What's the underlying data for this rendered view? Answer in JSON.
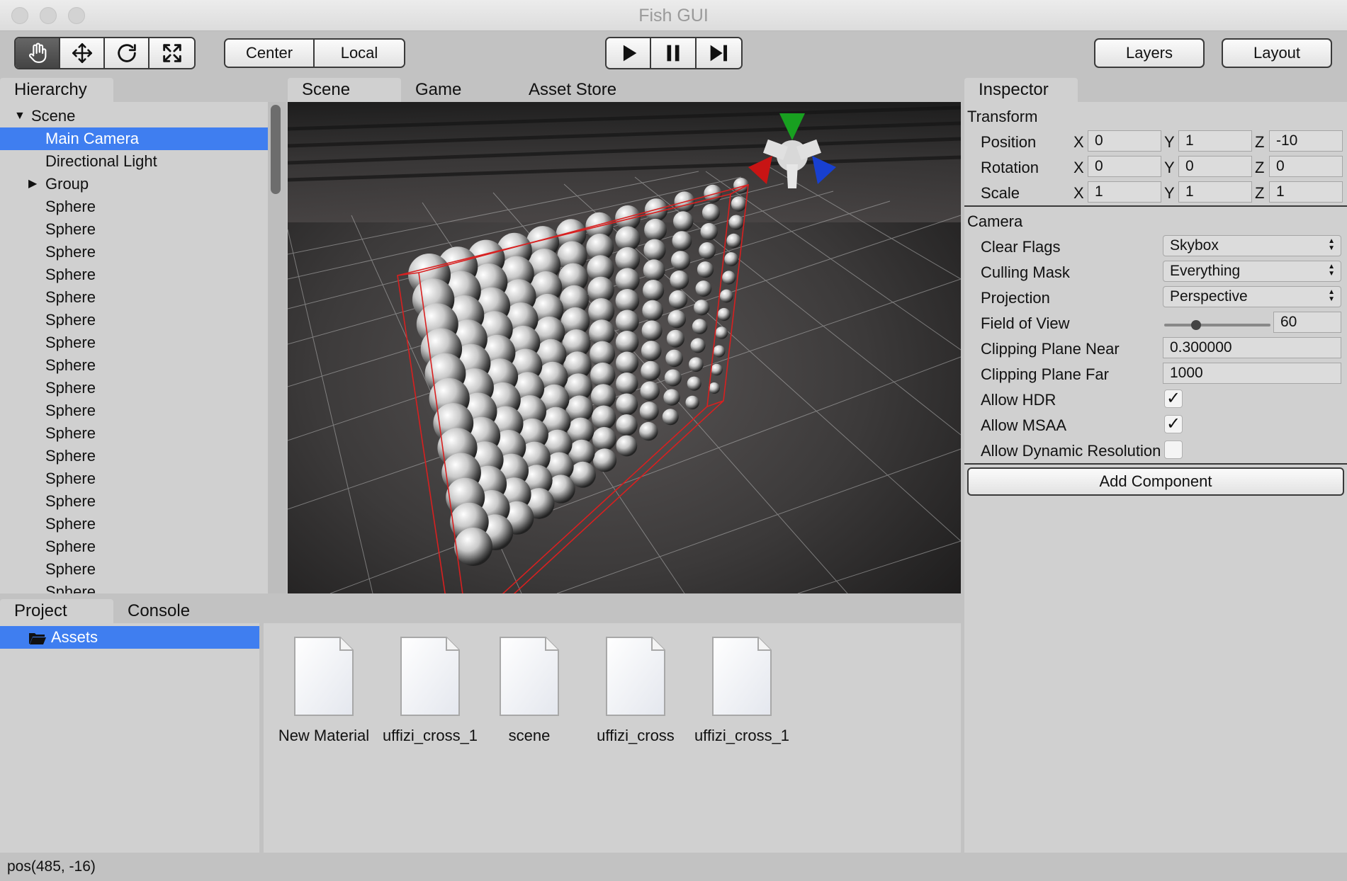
{
  "window": {
    "title": "Fish GUI"
  },
  "toolbar": {
    "tools": [
      {
        "name": "hand-tool",
        "icon": "hand-icon",
        "active": true
      },
      {
        "name": "move-tool",
        "icon": "move-arrows-icon",
        "active": false
      },
      {
        "name": "rotate-tool",
        "icon": "rotate-icon",
        "active": false
      },
      {
        "name": "scale-tool",
        "icon": "scale-icon",
        "active": false
      }
    ],
    "pivot": {
      "center_label": "Center",
      "local_label": "Local"
    },
    "playback": {
      "play_icon": "play-icon",
      "pause_icon": "pause-icon",
      "step_icon": "step-icon"
    },
    "layers_label": "Layers",
    "layout_label": "Layout"
  },
  "hierarchy": {
    "tab_label": "Hierarchy",
    "items": [
      {
        "label": "Scene",
        "indent": 0,
        "expander": "expanded"
      },
      {
        "label": "Main Camera",
        "indent": 1,
        "selected": true
      },
      {
        "label": "Directional Light",
        "indent": 1
      },
      {
        "label": "Group",
        "indent": 1,
        "expander": "collapsed"
      },
      {
        "label": "Sphere",
        "indent": 1
      },
      {
        "label": "Sphere",
        "indent": 1
      },
      {
        "label": "Sphere",
        "indent": 1
      },
      {
        "label": "Sphere",
        "indent": 1
      },
      {
        "label": "Sphere",
        "indent": 1
      },
      {
        "label": "Sphere",
        "indent": 1
      },
      {
        "label": "Sphere",
        "indent": 1
      },
      {
        "label": "Sphere",
        "indent": 1
      },
      {
        "label": "Sphere",
        "indent": 1
      },
      {
        "label": "Sphere",
        "indent": 1
      },
      {
        "label": "Sphere",
        "indent": 1
      },
      {
        "label": "Sphere",
        "indent": 1
      },
      {
        "label": "Sphere",
        "indent": 1
      },
      {
        "label": "Sphere",
        "indent": 1
      },
      {
        "label": "Sphere",
        "indent": 1
      },
      {
        "label": "Sphere",
        "indent": 1
      },
      {
        "label": "Sphere",
        "indent": 1
      },
      {
        "label": "Sphere",
        "indent": 1
      }
    ]
  },
  "center_tabs": [
    {
      "label": "Scene",
      "active": true
    },
    {
      "label": "Game",
      "active": false
    },
    {
      "label": "Asset Store",
      "active": false
    }
  ],
  "inspector": {
    "tab_label": "Inspector",
    "transform": {
      "title": "Transform",
      "rows": [
        {
          "label": "Position",
          "x": "0",
          "y": "1",
          "z": "-10"
        },
        {
          "label": "Rotation",
          "x": "0",
          "y": "0",
          "z": "0"
        },
        {
          "label": "Scale",
          "x": "1",
          "y": "1",
          "z": "1"
        }
      ],
      "axes": {
        "x": "X",
        "y": "Y",
        "z": "Z"
      }
    },
    "camera": {
      "title": "Camera",
      "clear_flags": {
        "label": "Clear Flags",
        "value": "Skybox"
      },
      "culling_mask": {
        "label": "Culling Mask",
        "value": "Everything"
      },
      "projection": {
        "label": "Projection",
        "value": "Perspective"
      },
      "field_of_view": {
        "label": "Field of View",
        "value": "60",
        "slider_fraction": 0.3
      },
      "clip_near": {
        "label": "Clipping Plane Near",
        "value": "0.300000"
      },
      "clip_far": {
        "label": "Clipping Plane Far",
        "value": "1000"
      },
      "allow_hdr": {
        "label": "Allow HDR",
        "checked": true,
        "check_glyph": "✓"
      },
      "allow_msaa": {
        "label": "Allow MSAA",
        "checked": true,
        "check_glyph": "✓"
      },
      "allow_dynamic_resolution": {
        "label": "Allow Dynamic Resolution",
        "checked": false,
        "check_glyph": ""
      }
    },
    "add_component_label": "Add Component"
  },
  "bottom_tabs": [
    {
      "label": "Project",
      "active": true
    },
    {
      "label": "Console",
      "active": false
    }
  ],
  "project": {
    "tree": [
      {
        "label": "Assets",
        "icon": "folder-open-icon",
        "selected": true
      }
    ],
    "assets": [
      {
        "name": "New Material",
        "icon": "file-icon"
      },
      {
        "name": "uffizi_cross_1",
        "icon": "file-icon"
      },
      {
        "name": "scene",
        "icon": "file-icon"
      },
      {
        "name": "uffizi_cross",
        "icon": "file-icon"
      },
      {
        "name": "uffizi_cross_1",
        "icon": "file-icon"
      }
    ]
  },
  "status": {
    "text": "pos(485, -16)"
  },
  "colors": {
    "selection": "#3f7ef0",
    "panel": "#d0d0d0",
    "chrome": "#c2c2c2",
    "bounds_box": "#d82020",
    "gizmo_x": "#c81414",
    "gizmo_y": "#18a020",
    "gizmo_z": "#1840d0"
  }
}
